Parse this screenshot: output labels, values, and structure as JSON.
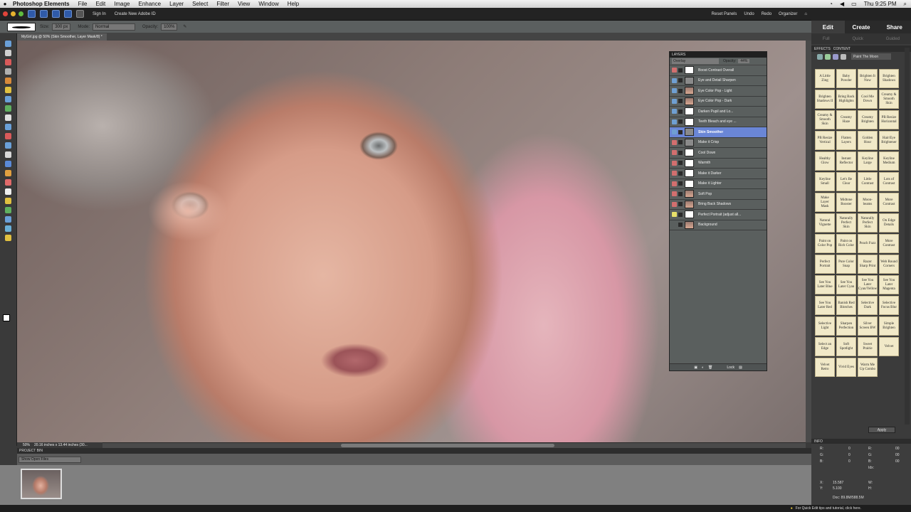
{
  "mac_menu": {
    "app_name": "Photoshop Elements",
    "items": [
      "File",
      "Edit",
      "Image",
      "Enhance",
      "Layer",
      "Select",
      "Filter",
      "View",
      "Window",
      "Help"
    ],
    "clock": "Thu 9:25 PM"
  },
  "app_bar": {
    "sign_in": "Sign In",
    "create_id": "Create New Adobe ID",
    "reset_panels": "Reset Panels",
    "undo": "Undo",
    "redo": "Redo",
    "organizer": "Organizer"
  },
  "modes": {
    "edit": "Edit",
    "create": "Create",
    "share": "Share",
    "sub": [
      "Full",
      "Quick",
      "Guided"
    ]
  },
  "options": {
    "size": "300 px",
    "mode_label": "Mode:",
    "mode_value": "Normal",
    "opacity_label": "Opacity:",
    "opacity_value": "100%"
  },
  "doc_tab": "MyGirl.jpg @ 50% (Skin Smoother, Layer Mask/8) *",
  "status": {
    "zoom": "50%",
    "dims": "20.16 inches x 13.44 inches (30..."
  },
  "project_bin": {
    "title": "PROJECT BIN",
    "filter": "Show Open Files"
  },
  "layers": {
    "title": "LAYERS",
    "blend": "Overlay",
    "opacity_label": "Opacity:",
    "opacity_value": "44%",
    "rows": [
      {
        "name": "Boost Contrast Overall",
        "eye": "#d26f6f",
        "sel": false
      },
      {
        "name": "Eye and Detail Sharpen",
        "eye": "#6f9fd2",
        "sel": false
      },
      {
        "name": "Eye Color Pop - Light",
        "eye": "#6f9fd2",
        "sel": false
      },
      {
        "name": "Eye Color Pop - Dark",
        "eye": "#6f9fd2",
        "sel": false
      },
      {
        "name": "Darken Pupil and Lo...",
        "eye": "#6f9fd2",
        "sel": false
      },
      {
        "name": "Teeth Bleach and eye ...",
        "eye": "#6f9fd2",
        "sel": false
      },
      {
        "name": "Skin Smoother",
        "eye": "#6f9fd2",
        "sel": true
      },
      {
        "name": "Make it Crisp",
        "eye": "#d26f6f",
        "sel": false
      },
      {
        "name": "Cool Down",
        "eye": "#d26f6f",
        "sel": false
      },
      {
        "name": "Warmth",
        "eye": "#d26f6f",
        "sel": false
      },
      {
        "name": "Make it Darker",
        "eye": "#d26f6f",
        "sel": false
      },
      {
        "name": "Make it Lighter",
        "eye": "#d26f6f",
        "sel": false
      },
      {
        "name": "Soft Pop",
        "eye": "#d26f6f",
        "sel": false
      },
      {
        "name": "Bring Back Shadows",
        "eye": "#d26f6f",
        "sel": false
      },
      {
        "name": "Perfect Portrait (adjust all...",
        "eye": "#e8e06a",
        "sel": false
      },
      {
        "name": "Background",
        "eye": "#5a5f5e",
        "sel": false
      }
    ],
    "lock": "Lock"
  },
  "effects": {
    "tab_effects": "EFFECTS",
    "tab_content": "CONTENT",
    "collection": "Paint The Moon",
    "apply": "Apply",
    "items": [
      "A Little Zing",
      "Baby Powder",
      "Brighten It Now",
      "Brighten Shadows",
      "Brighten Shadows II",
      "Bring Back Highlights",
      "Cool Me Down",
      "Creamy & Smooth Skin",
      "Creamy & Smooth Skin",
      "Creamy Haze",
      "Creamy Brighten",
      "PB Resize Horizontal",
      "PB Resize Vertical",
      "Flatten Layers",
      "Golden Hour",
      "Hair/Eye Brightener",
      "Healthy Glow",
      "Instant Reflector",
      "Keyline Large",
      "Keyline Medium",
      "Keyline Small",
      "Let's Be Clear",
      "Little Contrast",
      "Lots of Contrast",
      "Make Layer Mask",
      "Midtone Booster",
      "Moon-beams",
      "More Contrast",
      "Natural Vignette",
      "Naturally Perfect Skin",
      "Naturally Perfect Skin",
      "On Edge Details",
      "Paint on Color Pop",
      "Paint on Rich Color",
      "Peach Fuzz",
      "More Contrast",
      "Perfect Portrait",
      "Pure Color Snap",
      "Razor Sharp Print",
      "Web Round Corners",
      "See You Later Blue",
      "See You Later Cyan",
      "See You Later Cyan/Yellow",
      "See You Later Magenta",
      "See You Later Red",
      "Banish Red Blotches",
      "Selective Dark",
      "Selective Focus Blur",
      "Selective Light",
      "Sharpen Perfection",
      "Silver Screen BW",
      "Simple Brighten",
      "Select an Edge",
      "Soft Spotlight",
      "Sweet Prairie",
      "Velvet",
      "Velvet Retro",
      "Vivid Eyes",
      "Warm Me Up Combo"
    ]
  },
  "info": {
    "title": "INFO",
    "r": "R:",
    "g": "G:",
    "b": "B:",
    "rv": "0",
    "gv": "0",
    "bv": "0",
    "r2": "00",
    "g2": "00",
    "b2": "00",
    "idx": "Idx:",
    "x_label": "X:",
    "y_label": "Y:",
    "x": "15.587",
    "y": "5.100",
    "w": "W:",
    "h": "H:",
    "doc": "Doc: 89.8M/588.5M"
  },
  "bottom_tip": "For Quick Edit tips and tutorial, click here."
}
